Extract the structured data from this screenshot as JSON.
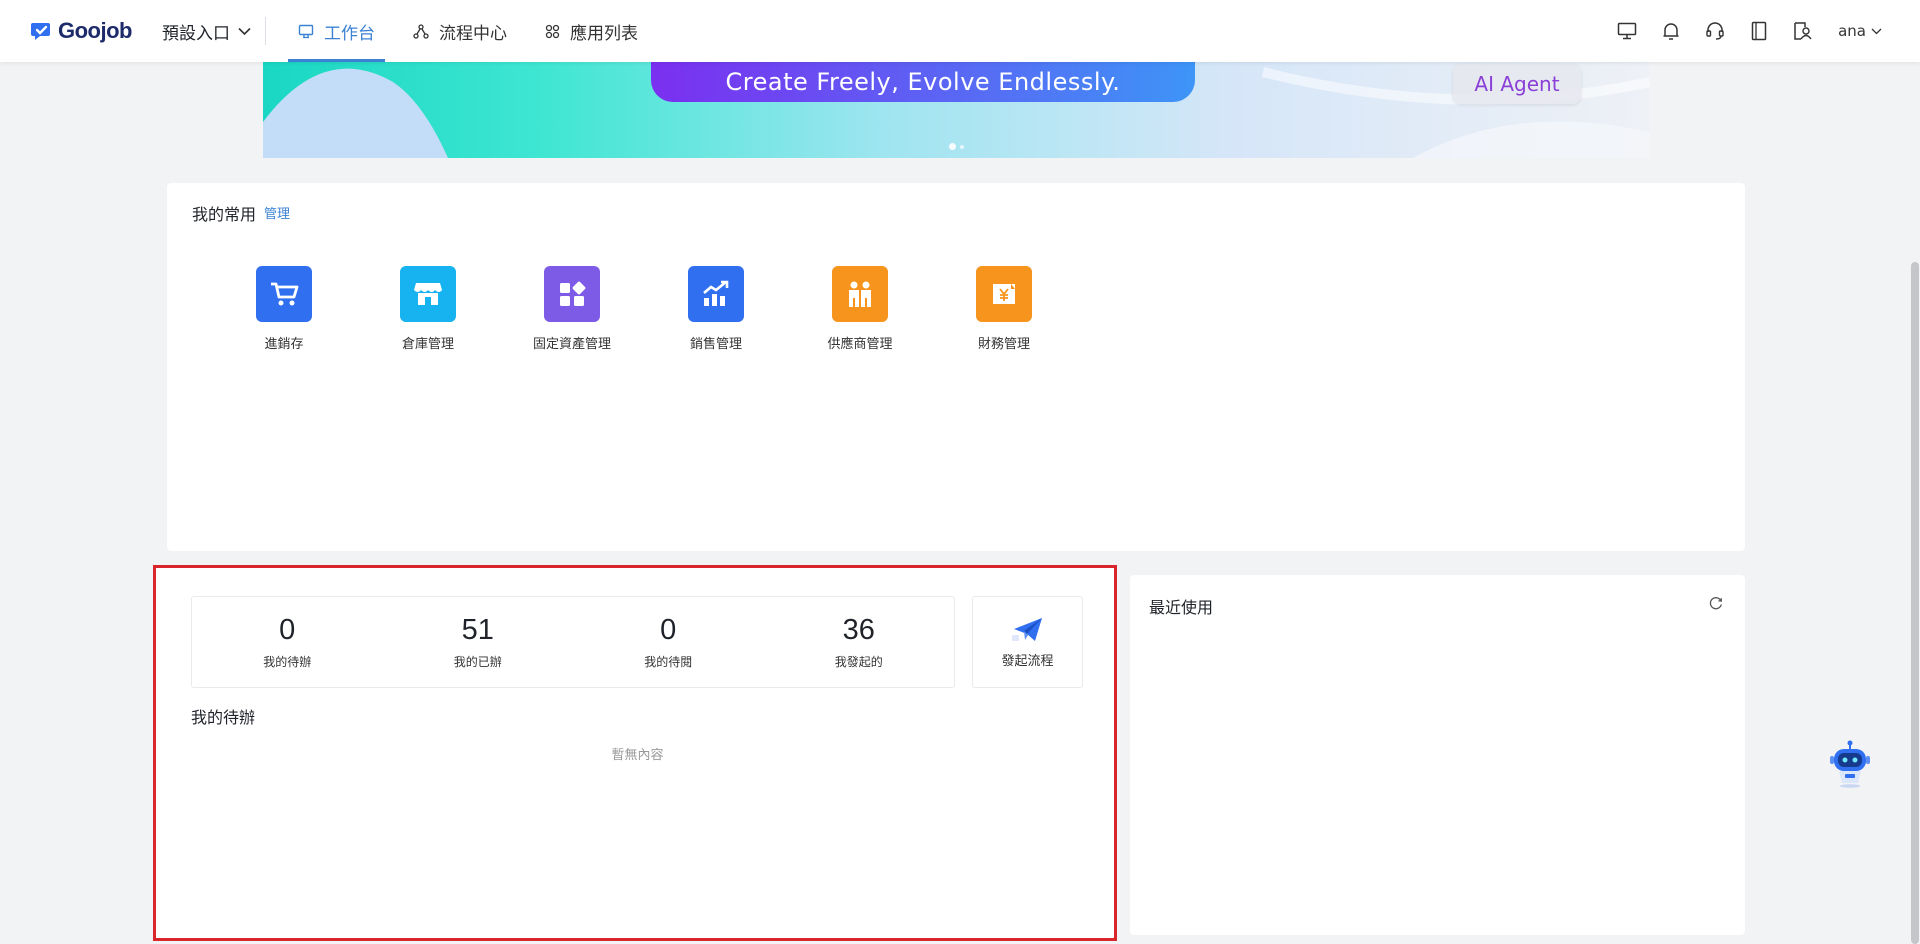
{
  "header": {
    "brand": "Goojob",
    "entry_label": "預設入口",
    "nav": [
      {
        "label": "工作台",
        "icon": "monitor-icon",
        "active": true
      },
      {
        "label": "流程中心",
        "icon": "flow-icon",
        "active": false
      },
      {
        "label": "應用列表",
        "icon": "apps-grid-icon",
        "active": false
      }
    ],
    "tools": [
      "desktop-icon",
      "bell-icon",
      "headset-icon",
      "book-icon",
      "user-switch-icon"
    ],
    "user_name": "ana",
    "accent_color": "#3b82d4"
  },
  "banner": {
    "slogan": "Create Freely, Evolve Endlessly.",
    "tag": "AI Agent",
    "slides": 2,
    "active_slide": 1
  },
  "favorites": {
    "title": "我的常用",
    "manage_label": "管理",
    "apps": [
      {
        "label": "進銷存",
        "icon": "cart-icon",
        "color": "#2f6ff0"
      },
      {
        "label": "倉庫管理",
        "icon": "store-icon",
        "color": "#17b2f0"
      },
      {
        "label": "固定資產管理",
        "icon": "asset-blocks-icon",
        "color": "#7d5be6"
      },
      {
        "label": "銷售管理",
        "icon": "sales-chart-icon",
        "color": "#2f6ff0"
      },
      {
        "label": "供應商管理",
        "icon": "supplier-icon",
        "color": "#f7941d"
      },
      {
        "label": "財務管理",
        "icon": "finance-icon",
        "color": "#f7941d"
      }
    ]
  },
  "todo": {
    "stats": [
      {
        "value": "0",
        "label": "我的待辦"
      },
      {
        "value": "51",
        "label": "我的已辦"
      },
      {
        "value": "0",
        "label": "我的待閱"
      },
      {
        "value": "36",
        "label": "我發起的"
      }
    ],
    "launch_label": "發起流程",
    "section_title": "我的待辦",
    "empty_text": "暫無內容"
  },
  "recent": {
    "title": "最近使用"
  }
}
